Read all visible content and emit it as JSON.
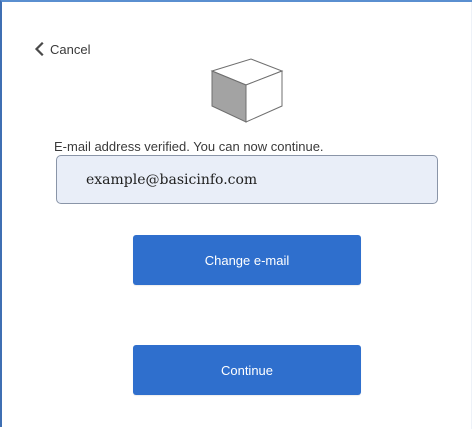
{
  "header": {
    "cancel_label": "Cancel",
    "cancel_icon": "chevron-left-icon",
    "logo_icon": "cube-icon"
  },
  "verification": {
    "message": "E-mail address verified. You can now continue.",
    "email_value": "example@basicinfo.com"
  },
  "actions": {
    "change_email_label": "Change e-mail",
    "continue_label": "Continue"
  },
  "colors": {
    "primary_button": "#2f6fcd",
    "field_background": "#e9eef8",
    "window_border": "#3f6fb3"
  }
}
